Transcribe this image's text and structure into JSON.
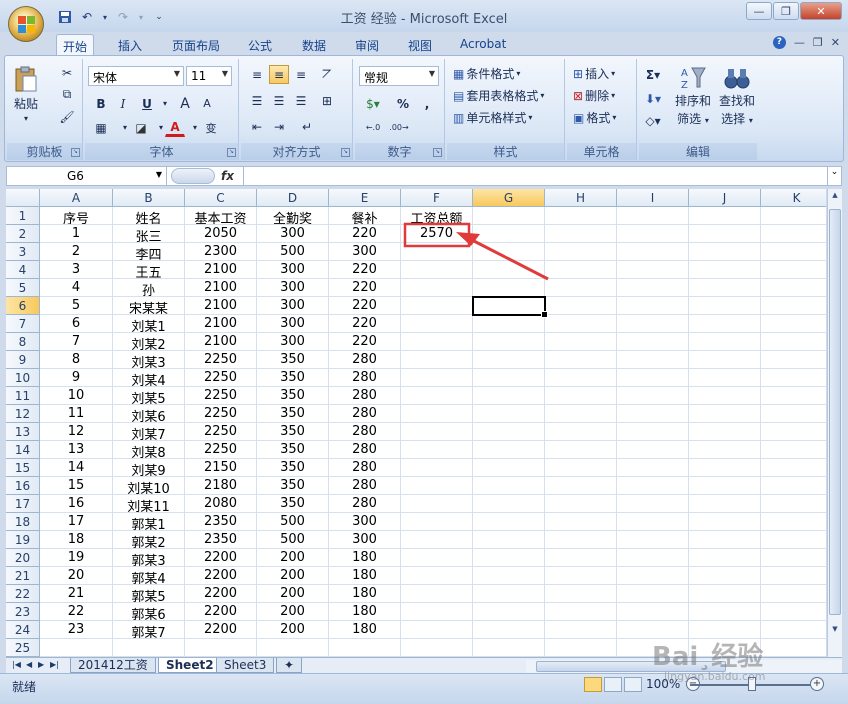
{
  "window": {
    "title": "工资 经验 - Microsoft Excel"
  },
  "ribbon_tabs": [
    "开始",
    "插入",
    "页面布局",
    "公式",
    "数据",
    "审阅",
    "视图",
    "Acrobat"
  ],
  "clipboard": {
    "paste": "粘贴",
    "group": "剪贴板"
  },
  "font": {
    "name": "宋体",
    "size": "11",
    "group": "字体",
    "bold": "B",
    "italic": "I",
    "underline": "U",
    "grow": "A",
    "shrink": "A",
    "wen": "变"
  },
  "alignment": {
    "group": "对齐方式"
  },
  "number": {
    "format": "常规",
    "percent": "%",
    "comma": ",",
    "inc": ".0​.00",
    "dec": ".00​.0",
    "group": "数字"
  },
  "styles": {
    "conditional": "条件格式",
    "table": "套用表格格式",
    "cell": "单元格样式",
    "group": "样式"
  },
  "cells": {
    "insert": "插入",
    "delete": "删除",
    "format": "格式",
    "group": "单元格"
  },
  "editing": {
    "sort": "排序和\n筛选",
    "sort1": "排序和",
    "sort2": "筛选",
    "find1": "查找和",
    "find2": "选择",
    "group": "编辑"
  },
  "formula_bar": {
    "name_box": "G6",
    "fx": "fx",
    "value": ""
  },
  "columns": [
    "A",
    "B",
    "C",
    "D",
    "E",
    "F",
    "G",
    "H",
    "I",
    "J",
    "K"
  ],
  "row_numbers": [
    "1",
    "2",
    "3",
    "4",
    "5",
    "6",
    "7",
    "8",
    "9",
    "10",
    "11",
    "12",
    "13",
    "14",
    "15",
    "16",
    "17",
    "18",
    "19",
    "20",
    "21",
    "22",
    "23",
    "24",
    "25"
  ],
  "grid": [
    [
      "序号",
      "姓名",
      "基本工资",
      "全勤奖",
      "餐补",
      "工资总额"
    ],
    [
      "1",
      "张三",
      "2050",
      "300",
      "220",
      "2570"
    ],
    [
      "2",
      "李四",
      "2300",
      "500",
      "300",
      ""
    ],
    [
      "3",
      "王五",
      "2100",
      "300",
      "220",
      ""
    ],
    [
      "4",
      "孙",
      "2100",
      "300",
      "220",
      ""
    ],
    [
      "5",
      "宋某某",
      "2100",
      "300",
      "220",
      ""
    ],
    [
      "6",
      "刘某1",
      "2100",
      "300",
      "220",
      ""
    ],
    [
      "7",
      "刘某2",
      "2100",
      "300",
      "220",
      ""
    ],
    [
      "8",
      "刘某3",
      "2250",
      "350",
      "280",
      ""
    ],
    [
      "9",
      "刘某4",
      "2250",
      "350",
      "280",
      ""
    ],
    [
      "10",
      "刘某5",
      "2250",
      "350",
      "280",
      ""
    ],
    [
      "11",
      "刘某6",
      "2250",
      "350",
      "280",
      ""
    ],
    [
      "12",
      "刘某7",
      "2250",
      "350",
      "280",
      ""
    ],
    [
      "13",
      "刘某8",
      "2250",
      "350",
      "280",
      ""
    ],
    [
      "14",
      "刘某9",
      "2150",
      "350",
      "280",
      ""
    ],
    [
      "15",
      "刘某10",
      "2180",
      "350",
      "280",
      ""
    ],
    [
      "16",
      "刘某11",
      "2080",
      "350",
      "280",
      ""
    ],
    [
      "17",
      "郭某1",
      "2350",
      "500",
      "300",
      ""
    ],
    [
      "18",
      "郭某2",
      "2350",
      "500",
      "300",
      ""
    ],
    [
      "19",
      "郭某3",
      "2200",
      "200",
      "180",
      ""
    ],
    [
      "20",
      "郭某4",
      "2200",
      "200",
      "180",
      ""
    ],
    [
      "21",
      "郭某5",
      "2200",
      "200",
      "180",
      ""
    ],
    [
      "22",
      "郭某6",
      "2200",
      "200",
      "180",
      ""
    ],
    [
      "23",
      "郭某7",
      "2200",
      "200",
      "180",
      ""
    ],
    [
      "",
      "",
      "",
      "",
      "",
      ""
    ]
  ],
  "sheet_tabs": [
    "201412工资",
    "Sheet2",
    "Sheet3"
  ],
  "status": {
    "ready": "就绪",
    "zoom": "100%"
  },
  "watermark": {
    "logo": "Bai¸经验",
    "url": "jingyan.baidu.com"
  },
  "colors": {
    "annotation": "#e03a3a",
    "ribbon_text": "#15428b"
  }
}
